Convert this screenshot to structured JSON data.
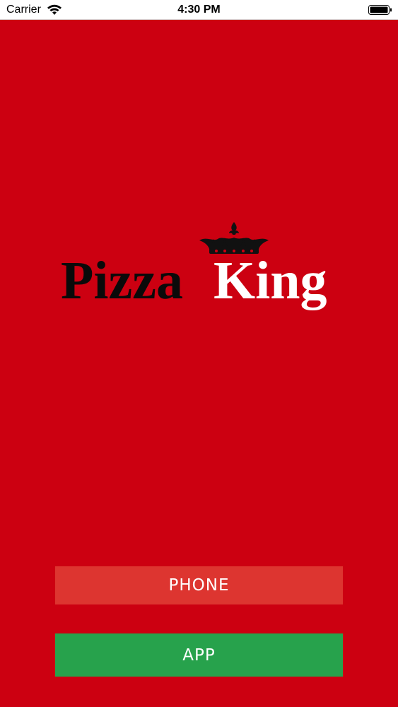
{
  "status_bar": {
    "carrier": "Carrier",
    "time": "4:30 PM",
    "icons": [
      "wifi-icon",
      "battery-icon"
    ]
  },
  "logo": {
    "word_1": "Pizza",
    "word_2": "King",
    "icon": "crown-icon"
  },
  "buttons": {
    "phone_label": "PHONE",
    "app_label": "APP"
  },
  "colors": {
    "background": "#cc0011",
    "phone_button": "#dd3530",
    "app_button": "#27a24c",
    "logo_dark": "#0a0a0a",
    "logo_light": "#ffffff"
  }
}
